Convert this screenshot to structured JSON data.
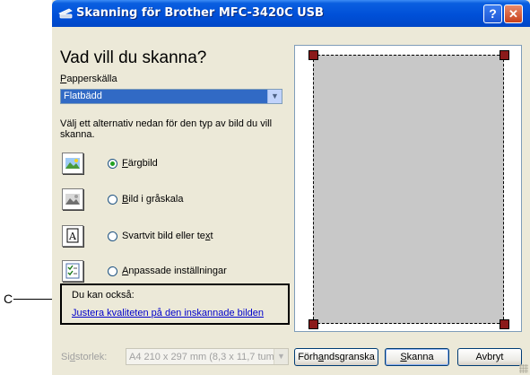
{
  "callout": {
    "label": "C"
  },
  "window": {
    "title": "Skanning för Brother MFC-3420C USB",
    "help_label": "?",
    "close_label": "✕"
  },
  "left": {
    "heading": "Vad vill du skanna?",
    "source_label_hot": "P",
    "source_label_rest": "apperskälla",
    "source_value": "Flatbädd",
    "instructions": "Välj ett alternativ nedan för den typ av bild du vill skanna.",
    "options": [
      {
        "pre": "",
        "hot": "F",
        "post": "ärgbild",
        "checked": true
      },
      {
        "pre": "",
        "hot": "B",
        "post": "ild i gråskala",
        "checked": false
      },
      {
        "pre": "Svartvit bild eller te",
        "hot": "x",
        "post": "t",
        "checked": false
      },
      {
        "pre": "",
        "hot": "A",
        "post": "npassade inställningar",
        "checked": false
      }
    ],
    "also_title": "Du kan också:",
    "also_link": "Justera kvaliteten på den inskannade bilden"
  },
  "footer": {
    "size_label_pre": "Si",
    "size_label_hot": "d",
    "size_label_post": "storlek:",
    "size_value": "A4 210 x 297 mm (8,3 x 11,7 tum",
    "preview_pre": "Förh",
    "preview_hot": "a",
    "preview_post": "ndsgranska",
    "scan_hot": "S",
    "scan_post": "kanna",
    "cancel_label": "Avbryt"
  },
  "colors": {
    "titlebar": "#0050d8",
    "selection": "#316ac5",
    "link": "#0000cc",
    "handle": "#8b1a1a"
  }
}
